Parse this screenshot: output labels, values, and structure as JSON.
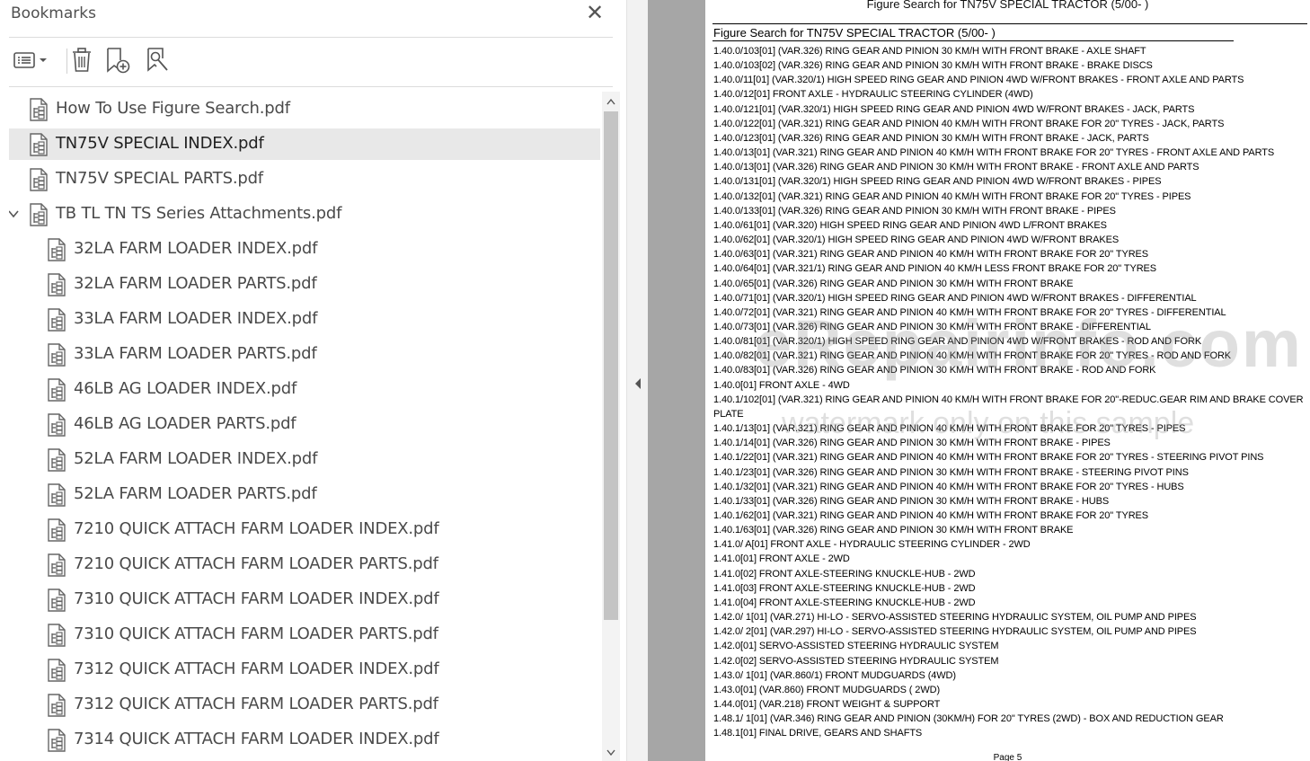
{
  "bookmarks_panel": {
    "title": "Bookmarks",
    "close_icon": "close-icon",
    "toolbar": {
      "options_icon": "list-options-icon",
      "delete_icon": "trash-icon",
      "new_bookmark_icon": "add-bookmark-icon",
      "find_bookmark_icon": "find-bookmark-icon"
    },
    "items": [
      {
        "label": "How To Use Figure Search.pdf",
        "level": 0,
        "selected": false
      },
      {
        "label": "TN75V SPECIAL INDEX.pdf",
        "level": 0,
        "selected": true
      },
      {
        "label": "TN75V SPECIAL PARTS.pdf",
        "level": 0,
        "selected": false
      },
      {
        "label": "TB TL TN TS Series Attachments.pdf",
        "level": 0,
        "selected": false,
        "expanded": true
      },
      {
        "label": "32LA FARM LOADER INDEX.pdf",
        "level": 1,
        "selected": false
      },
      {
        "label": "32LA FARM LOADER PARTS.pdf",
        "level": 1,
        "selected": false
      },
      {
        "label": "33LA FARM LOADER INDEX.pdf",
        "level": 1,
        "selected": false
      },
      {
        "label": "33LA FARM LOADER PARTS.pdf",
        "level": 1,
        "selected": false
      },
      {
        "label": "46LB AG LOADER INDEX.pdf",
        "level": 1,
        "selected": false
      },
      {
        "label": "46LB AG LOADER PARTS.pdf",
        "level": 1,
        "selected": false
      },
      {
        "label": "52LA FARM LOADER INDEX.pdf",
        "level": 1,
        "selected": false
      },
      {
        "label": "52LA FARM LOADER PARTS.pdf",
        "level": 1,
        "selected": false
      },
      {
        "label": "7210 QUICK ATTACH FARM LOADER INDEX.pdf",
        "level": 1,
        "selected": false
      },
      {
        "label": "7210 QUICK ATTACH FARM LOADER PARTS.pdf",
        "level": 1,
        "selected": false
      },
      {
        "label": "7310 QUICK ATTACH FARM LOADER INDEX.pdf",
        "level": 1,
        "selected": false
      },
      {
        "label": "7310 QUICK ATTACH FARM LOADER PARTS.pdf",
        "level": 1,
        "selected": false
      },
      {
        "label": "7312 QUICK ATTACH FARM LOADER INDEX.pdf",
        "level": 1,
        "selected": false
      },
      {
        "label": "7312 QUICK ATTACH FARM LOADER PARTS.pdf",
        "level": 1,
        "selected": false
      },
      {
        "label": "7314 QUICK ATTACH FARM LOADER INDEX.pdf",
        "level": 1,
        "selected": false
      }
    ]
  },
  "document": {
    "header": "Figure Search for TN75V SPECIAL TRACTOR (5/00- )",
    "subtitle": "Figure Search for TN75V SPECIAL TRACTOR (5/00- )",
    "lines": [
      "1.40.0/103[01] (VAR.326) RING GEAR AND PINION 30 KM/H WITH FRONT BRAKE - AXLE SHAFT",
      "1.40.0/103[02] (VAR.326) RING GEAR AND PINION 30 KM/H WITH FRONT BRAKE - BRAKE DISCS",
      "1.40.0/11[01] (VAR.320/1) HIGH SPEED RING GEAR AND PINION 4WD W/FRONT BRAKES - FRONT AXLE AND PARTS",
      "1.40.0/12[01] FRONT AXLE - HYDRAULIC STEERING CYLINDER (4WD)",
      "1.40.0/121[01] (VAR.320/1) HIGH SPEED RING GEAR AND PINION 4WD W/FRONT BRAKES - JACK, PARTS",
      "1.40.0/122[01] (VAR.321) RING GEAR AND PINION 40 KM/H WITH FRONT BRAKE FOR 20\" TYRES - JACK, PARTS",
      "1.40.0/123[01] (VAR.326) RING GEAR AND PINION 30 KM/H WITH FRONT BRAKE - JACK, PARTS",
      "1.40.0/13[01] (VAR.321) RING GEAR AND PINION 40 KM/H WITH FRONT BRAKE FOR 20\" TYRES - FRONT AXLE AND PARTS",
      "1.40.0/13[01] (VAR.326) RING GEAR AND PINION 30 KM/H WITH FRONT BRAKE - FRONT AXLE AND PARTS",
      "1.40.0/131[01] (VAR.320/1) HIGH SPEED RING GEAR AND PINION 4WD W/FRONT BRAKES - PIPES",
      "1.40.0/132[01] (VAR.321) RING GEAR AND PINION 40 KM/H WITH FRONT BRAKE FOR 20\" TYRES - PIPES",
      "1.40.0/133[01] (VAR.326) RING GEAR AND PINION 30 KM/H WITH FRONT BRAKE - PIPES",
      "1.40.0/61[01] (VAR.320) HIGH SPEED RING GEAR AND PINION 4WD L/FRONT BRAKES",
      "1.40.0/62[01] (VAR.320/1) HIGH SPEED RING GEAR AND PINION 4WD W/FRONT BRAKES",
      "1.40.0/63[01] (VAR.321) RING GEAR AND PINION 40 KM/H WITH FRONT BRAKE FOR 20\" TYRES",
      "1.40.0/64[01] (VAR.321/1) RING GEAR AND PINION 40 KM/H LESS FRONT BRAKE FOR 20\" TYRES",
      "1.40.0/65[01] (VAR.326) RING GEAR AND PINION 30 KM/H WITH FRONT BRAKE",
      "1.40.0/71[01] (VAR.320/1) HIGH SPEED RING GEAR AND PINION 4WD W/FRONT BRAKES - DIFFERENTIAL",
      "1.40.0/72[01] (VAR.321) RING GEAR AND PINION 40 KM/H WITH FRONT BRAKE FOR 20\" TYRES - DIFFERENTIAL",
      "1.40.0/73[01] (VAR.326) RING GEAR AND PINION 30 KM/H WITH FRONT BRAKE - DIFFERENTIAL",
      "1.40.0/81[01] (VAR.320/1) HIGH SPEED RING GEAR AND PINION 4WD W/FRONT BRAKES - ROD AND FORK",
      "1.40.0/82[01] (VAR.321) RING GEAR AND PINION 40 KM/H WITH FRONT BRAKE FOR 20\" TYRES - ROD AND FORK",
      "1.40.0/83[01] (VAR.326) RING GEAR AND PINION 30 KM/H WITH FRONT BRAKE - ROD AND FORK",
      "1.40.0[01] FRONT AXLE - 4WD",
      "1.40.1/102[01] (VAR.321) RING GEAR AND PINION 40 KM/H WITH FRONT BRAKE FOR 20\"-REDUC.GEAR RIM AND BRAKE COVER PLATE",
      "1.40.1/13[01] (VAR.321) RING GEAR AND PINION 40 KM/H WITH FRONT BRAKE FOR 20\" TYRES - PIPES",
      "1.40.1/14[01] (VAR.326) RING GEAR AND PINION 30 KM/H WITH FRONT BRAKE - PIPES",
      "1.40.1/22[01] (VAR.321) RING GEAR AND PINION 40 KM/H WITH FRONT BRAKE FOR 20\" TYRES - STEERING PIVOT PINS",
      "1.40.1/23[01] (VAR.326) RING GEAR AND PINION 30 KM/H WITH FRONT BRAKE - STEERING PIVOT PINS",
      "1.40.1/32[01] (VAR.321) RING GEAR AND PINION 40 KM/H WITH FRONT BRAKE FOR 20\" TYRES - HUBS",
      "1.40.1/33[01] (VAR.326) RING GEAR AND PINION 30 KM/H WITH FRONT BRAKE - HUBS",
      "1.40.1/62[01] (VAR.321) RING GEAR AND PINION 40 KM/H WITH FRONT BRAKE FOR 20\" TYRES",
      "1.40.1/63[01] (VAR.326) RING GEAR AND PINION 30 KM/H WITH FRONT BRAKE",
      "1.41.0/  A[01] FRONT AXLE - HYDRAULIC STEERING CYLINDER - 2WD",
      "1.41.0[01] FRONT AXLE - 2WD",
      "1.41.0[02] FRONT AXLE-STEERING KNUCKLE-HUB - 2WD",
      "1.41.0[03] FRONT AXLE-STEERING KNUCKLE-HUB - 2WD",
      "1.41.0[04] FRONT AXLE-STEERING KNUCKLE-HUB - 2WD",
      "1.42.0/ 1[01] (VAR.271) HI-LO - SERVO-ASSISTED STEERING HYDRAULIC SYSTEM, OIL PUMP AND PIPES",
      "1.42.0/ 2[01] (VAR.297) HI-LO - SERVO-ASSISTED STEERING HYDRAULIC SYSTEM, OIL PUMP AND PIPES",
      "1.42.0[01] SERVO-ASSISTED STEERING HYDRAULIC SYSTEM",
      "1.42.0[02] SERVO-ASSISTED STEERING HYDRAULIC SYSTEM",
      "1.43.0/ 1[01] (VAR.860/1) FRONT MUDGUARDS (4WD)",
      "1.43.0[01] (VAR.860) FRONT MUDGUARDS ( 2WD)",
      "1.44.0[01] (VAR.218) FRONT WEIGHT & SUPPORT",
      "1.48.1/ 1[01] (VAR.346) RING GEAR AND PINION (30KM/H) FOR 20\" TYRES (2WD) - BOX AND REDUCTION GEAR",
      "1.48.1[01] FINAL DRIVE, GEARS AND SHAFTS"
    ],
    "page_number": "Page 5",
    "watermark_big": "eRepairinfo.com",
    "watermark_small": "watermark only on this sample"
  },
  "colors": {
    "panel_bg": "#ffffff",
    "selected_row": "#e8e8e8",
    "viewer_bg": "#a6a6a6",
    "text": "#4a4a4a"
  }
}
